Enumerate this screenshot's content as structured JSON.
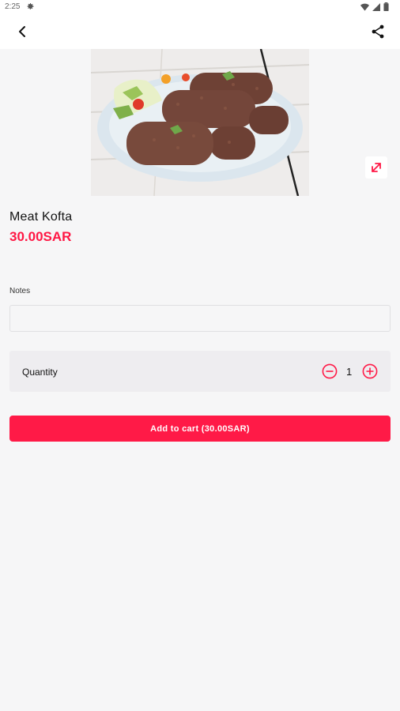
{
  "status_bar": {
    "time": "2:25"
  },
  "product": {
    "name": "Meat Kofta",
    "price": "30.00SAR"
  },
  "notes": {
    "label": "Notes",
    "value": "",
    "placeholder": ""
  },
  "quantity": {
    "label": "Quantity",
    "value": "1"
  },
  "cart_button": {
    "label": "Add to cart (30.00SAR)"
  },
  "colors": {
    "accent": "#ff1a47",
    "background": "#f6f6f7"
  }
}
